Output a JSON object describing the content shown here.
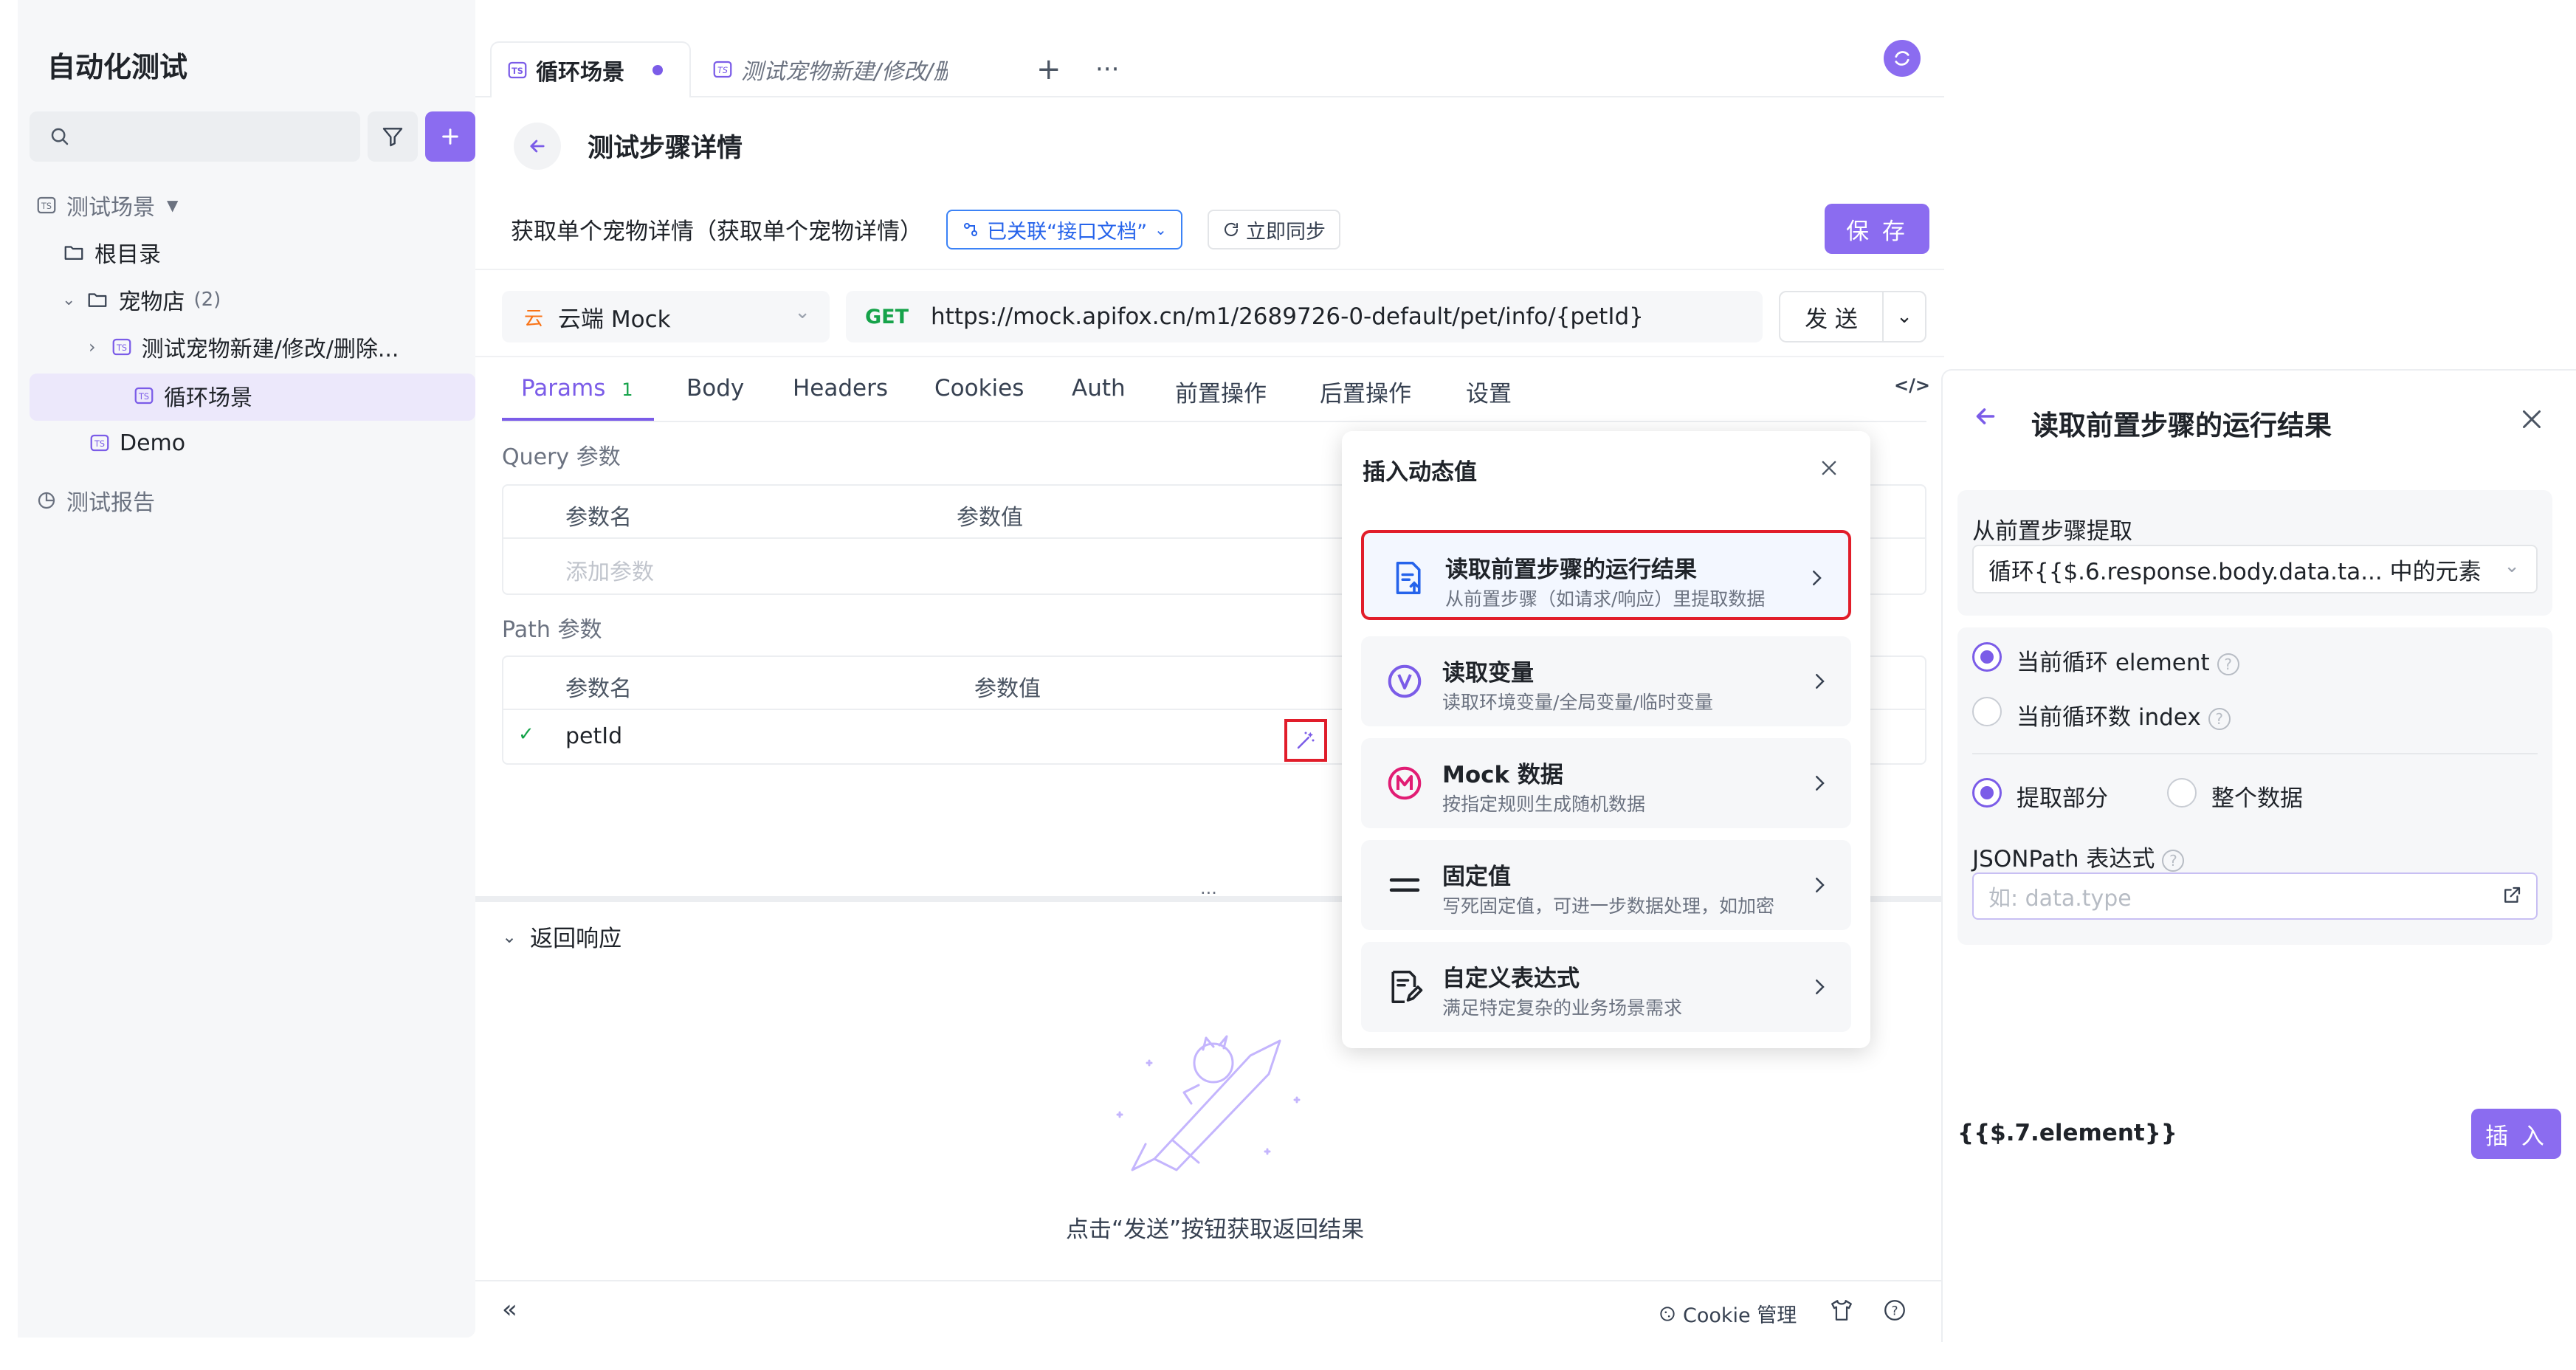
{
  "sidebar": {
    "title": "自动化测试",
    "search_placeholder": "",
    "tree": {
      "scenes_label": "测试场景",
      "root_label": "根目录",
      "folder_label": "宠物店",
      "folder_count": "(2)",
      "item1_label": "测试宠物新建/修改/删除...",
      "item2_label": "循环场景",
      "demo_label": "Demo",
      "report_label": "测试报告"
    }
  },
  "tabs": {
    "active_label": "循环场景",
    "second_label": "测试宠物新建/修改/删"
  },
  "detail": {
    "title": "测试步骤详情",
    "api_title": "获取单个宠物详情（获取单个宠物详情）",
    "linked_label": "已关联“接口文档”",
    "sync_label": "立即同步",
    "save_label": "保 存"
  },
  "request": {
    "env_icon": "云",
    "env_label": "云端 Mock",
    "method": "GET",
    "url": "https://mock.apifox.cn/m1/2689726-0-default/pet/info/{petId}",
    "send_label": "发 送"
  },
  "param_tabs": {
    "params_label": "Params",
    "params_count": "1",
    "body": "Body",
    "headers": "Headers",
    "cookies": "Cookies",
    "auth": "Auth",
    "pre": "前置操作",
    "post": "后置操作",
    "settings": "设置"
  },
  "query": {
    "section_label": "Query 参数",
    "col_name": "参数名",
    "col_value": "参数值",
    "add_placeholder": "添加参数"
  },
  "path": {
    "section_label": "Path 参数",
    "col_name": "参数名",
    "col_value": "参数值",
    "row_name": "petId"
  },
  "response": {
    "title": "返回响应",
    "hint": "点击“发送”按钮获取返回结果"
  },
  "footer": {
    "cookie_label": "Cookie 管理"
  },
  "popup": {
    "title": "插入动态值",
    "items": [
      {
        "title": "读取前置步骤的运行结果",
        "subtitle": "从前置步骤（如请求/响应）里提取数据"
      },
      {
        "title": "读取变量",
        "subtitle": "读取环境变量/全局变量/临时变量"
      },
      {
        "title": "Mock 数据",
        "subtitle": "按指定规则生成随机数据"
      },
      {
        "title": "固定值",
        "subtitle": "写死固定值，可进一步数据处理，如加密"
      },
      {
        "title": "自定义表达式",
        "subtitle": "满足特定复杂的业务场景需求"
      }
    ]
  },
  "panel": {
    "title": "读取前置步骤的运行结果",
    "extract_label": "从前置步骤提取",
    "extract_value": "循环{{$.6.response.body.data.ta... 中的元素",
    "radio_element": "当前循环 element",
    "radio_index": "当前循环数 index",
    "radio_part": "提取部分",
    "radio_whole": "整个数据",
    "jsonpath_label": "JSONPath 表达式",
    "jsonpath_placeholder": "如: data.type",
    "expression": "{{$.7.element}}",
    "insert_label": "插 入"
  },
  "colors": {
    "accent": "#8b6cf0",
    "highlight_border": "#e11d2a",
    "method_get": "#16a34a",
    "link_blue": "#2563eb"
  }
}
